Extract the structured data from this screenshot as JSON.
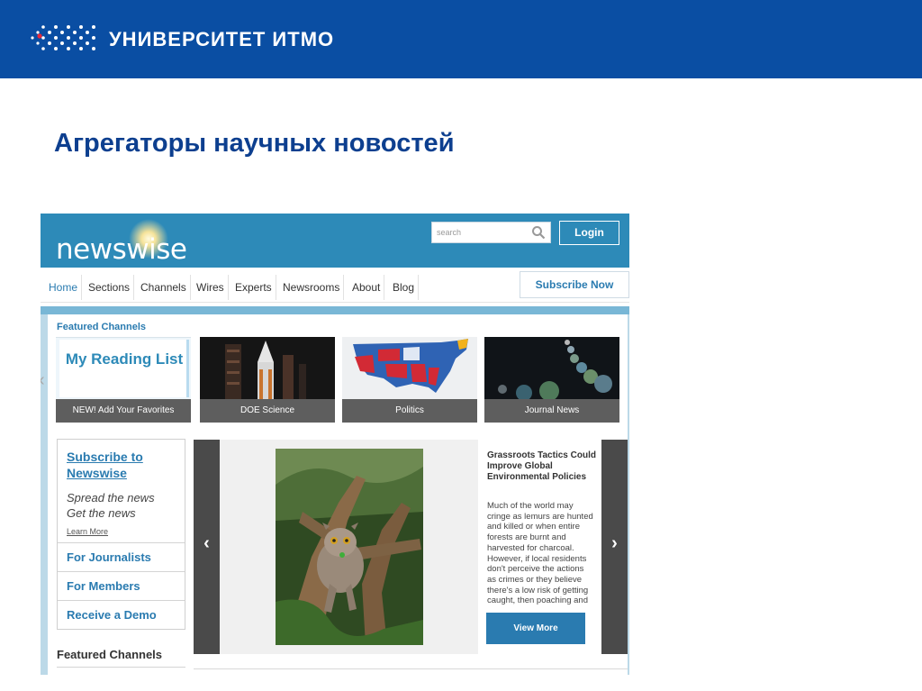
{
  "banner": {
    "university_name": "УНИВЕРСИТЕТ ИТМО",
    "logo_icon": "itmo-dots-logo",
    "background": "#0a4ea3"
  },
  "slide": {
    "title": "Агрегаторы научных новостей",
    "title_color": "#0d3f8f"
  },
  "newswise": {
    "logo": "newswise",
    "search_placeholder": "search",
    "search_icon": "magnifier-icon",
    "login_label": "Login",
    "header_color": "#2d8ab8",
    "nav": [
      "Home",
      "Sections",
      "Channels",
      "Wires",
      "Experts",
      "Newsrooms",
      "About",
      "Blog"
    ],
    "active_nav": "Home",
    "subscribe_now": "Subscribe Now",
    "featured_channels_label": "Featured Channels",
    "tiles": [
      {
        "image_text": "My Reading List",
        "caption": "NEW! Add Your Favorites"
      },
      {
        "caption": "DOE Science"
      },
      {
        "caption": "Politics"
      },
      {
        "caption": "Journal News"
      }
    ],
    "sidebar": {
      "title": "Subscribe to Newswise",
      "line1": "Spread the news",
      "line2": "Get the news",
      "learn_more": "Learn More",
      "links": [
        "For Journalists",
        "For Members",
        "Receive a Demo"
      ]
    },
    "featured_channels_bottom": "Featured Channels",
    "carousel": {
      "headline": "Grassroots Tactics Could Improve Global Environmental Policies",
      "body": "Much of the world may cringe as lemurs are hunted and killed or when entire forests are burnt and harvested for charcoal. However, if local residents don't perceive the actions as crimes or they believe there's a low risk of getting caught, then poaching and",
      "view_more": "View More",
      "prev_icon": "chevron-left-icon",
      "next_icon": "chevron-right-icon"
    }
  }
}
